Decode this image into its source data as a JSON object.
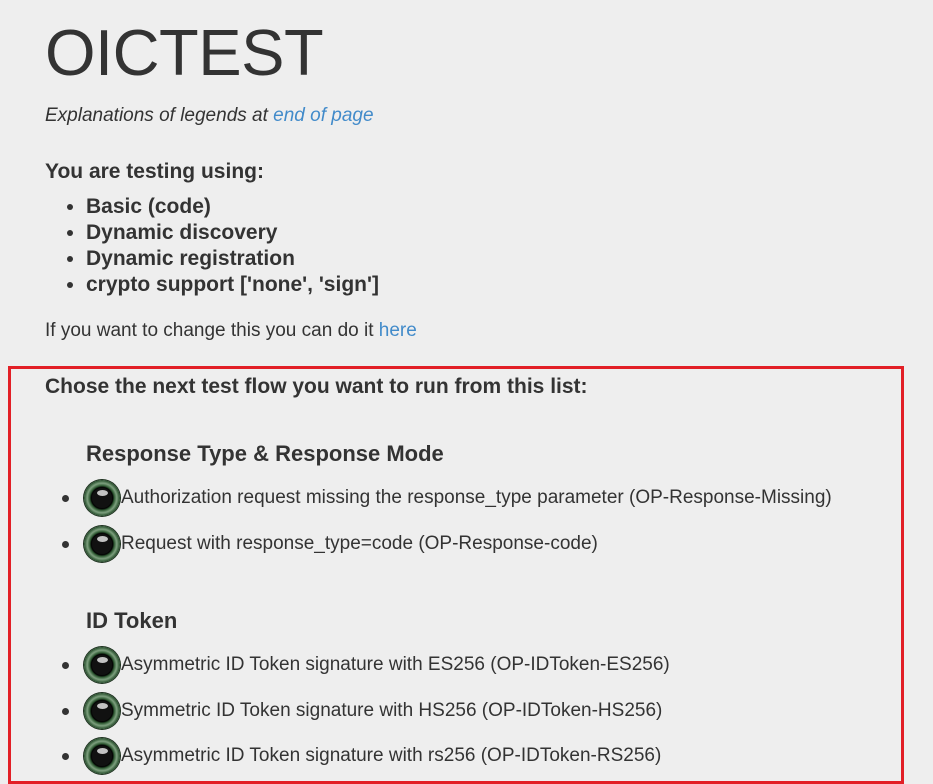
{
  "header": {
    "title": "OICTEST",
    "legend_prefix": "Explanations of legends at ",
    "legend_link": "end of page"
  },
  "testing": {
    "title": "You are testing using:",
    "items": [
      "Basic (code)",
      "Dynamic discovery",
      "Dynamic registration",
      "crypto support ['none', 'sign']"
    ]
  },
  "change": {
    "prefix": "If you want to change this you can do it ",
    "link": "here"
  },
  "flows": {
    "title": "Chose the next test flow you want to run from this list:",
    "sections": [
      {
        "heading": "Response Type & Response Mode",
        "tests": [
          "Authorization request missing the response_type parameter (OP-Response-Missing)",
          "Request with response_type=code (OP-Response-code)"
        ]
      },
      {
        "heading": "ID Token",
        "tests": [
          "Asymmetric ID Token signature with ES256 (OP-IDToken-ES256)",
          "Symmetric ID Token signature with HS256 (OP-IDToken-HS256)",
          "Asymmetric ID Token signature with rs256 (OP-IDToken-RS256)"
        ]
      }
    ]
  },
  "colors": {
    "link": "#428bca",
    "highlight_border": "#e21f26",
    "background": "#eeeeee"
  },
  "icons": {
    "status": "status-orb-icon"
  }
}
